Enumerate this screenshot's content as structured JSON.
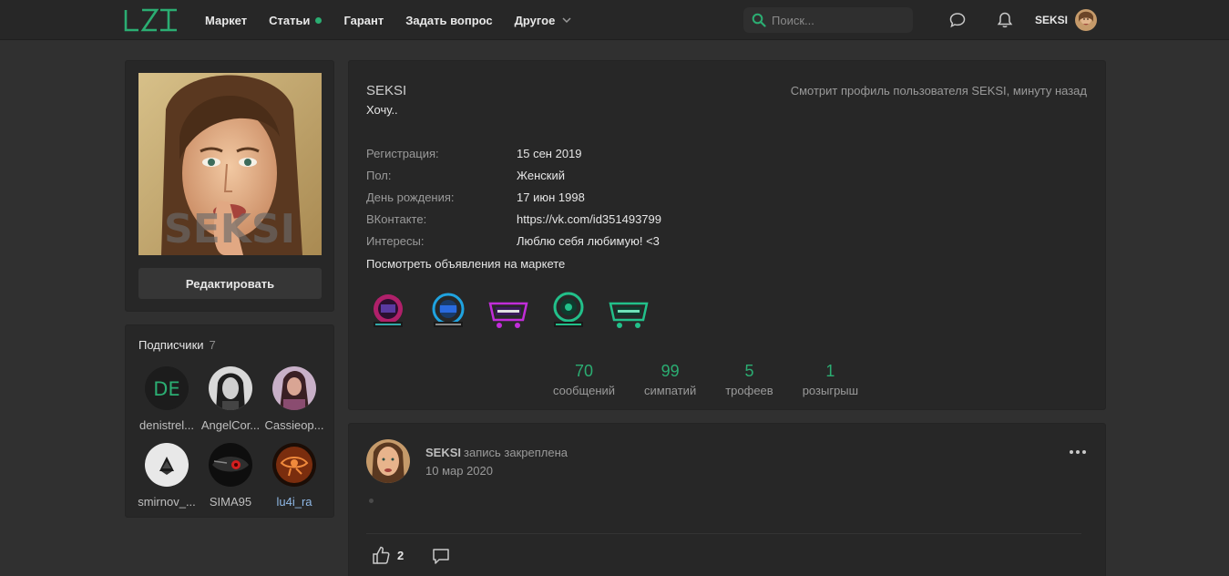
{
  "header": {
    "logo_text": "LZT",
    "nav": [
      {
        "label": "Маркет"
      },
      {
        "label": "Статьи",
        "has_dot": true
      },
      {
        "label": "Гарант"
      },
      {
        "label": "Задать вопрос"
      },
      {
        "label": "Другое",
        "has_dropdown": true
      }
    ],
    "search": {
      "placeholder": "Поиск..."
    },
    "icons": [
      "chat-icon",
      "bell-icon"
    ],
    "user": {
      "name": "SEKSI"
    }
  },
  "sidebar": {
    "avatar_watermark": "SEKSI",
    "edit_label": "Редактировать",
    "subscribers": {
      "title": "Подписчики",
      "count": "7",
      "items": [
        {
          "name": "denistrel...",
          "initials": "DE"
        },
        {
          "name": "AngelCor..."
        },
        {
          "name": "Cassieop..."
        },
        {
          "name": "smirnov_..."
        },
        {
          "name": "SIMA95"
        },
        {
          "name": "lu4i_ra"
        }
      ]
    }
  },
  "profile": {
    "name": "SEKSI",
    "status": "Хочу..",
    "activity": "Смотрит профиль пользователя SEKSI, минуту назад",
    "info": [
      {
        "key": "Регистрация:",
        "value": "15 сен 2019"
      },
      {
        "key": "Пол:",
        "value": "Женский"
      },
      {
        "key": "День рождения:",
        "value": "17 июн 1998"
      },
      {
        "key": "ВКонтакте:",
        "value": "https://vk.com/id351493799"
      },
      {
        "key": "Интересы:",
        "value": "Люблю себя любимую! <3"
      }
    ],
    "market_link": "Посмотреть объявления на маркете",
    "stats": [
      {
        "value": "70",
        "label": "сообщений"
      },
      {
        "value": "99",
        "label": "симпатий"
      },
      {
        "value": "5",
        "label": "трофеев"
      },
      {
        "value": "1",
        "label": "розыгрыш"
      }
    ]
  },
  "post": {
    "author": "SEKSI",
    "action": "запись закреплена",
    "date": "10 мар 2020",
    "likes": "2"
  },
  "colors": {
    "accent": "#2bad72",
    "background": "#303030",
    "panel": "#272727"
  }
}
